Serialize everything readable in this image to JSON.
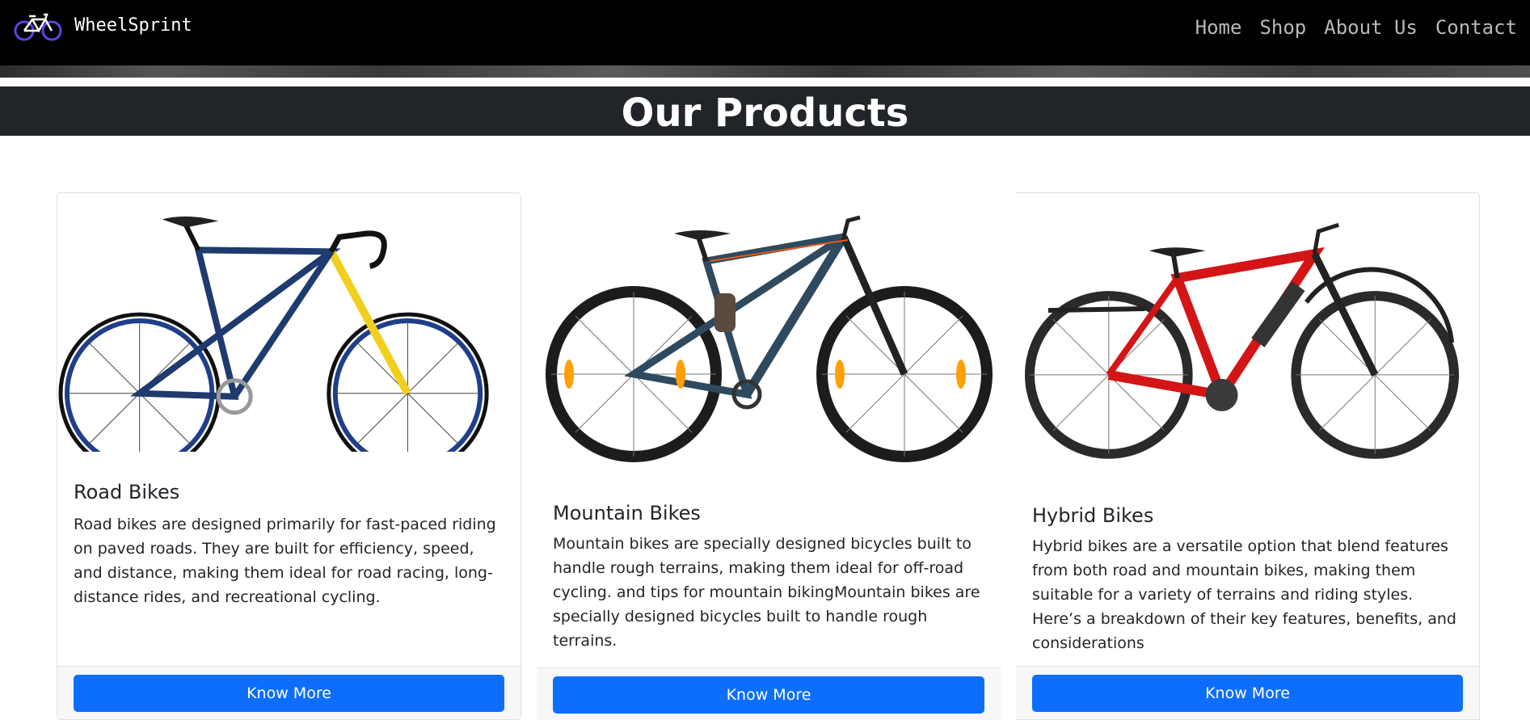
{
  "brand": {
    "name": "WheelSprint",
    "logo": "bike-icon"
  },
  "nav": {
    "items": [
      "Home",
      "Shop",
      "About Us",
      "Contact"
    ]
  },
  "section": {
    "title": "Our Products"
  },
  "products": [
    {
      "title": "Road Bikes",
      "description": "Road bikes are designed primarily for fast-paced riding on paved roads. They are built for efficiency, speed, and distance, making them ideal for road racing, long-distance rides, and recreational cycling.",
      "button": "Know More",
      "frame_color": "#1e3a6e",
      "accent_color": "#f2cf1f"
    },
    {
      "title": "Mountain Bikes",
      "description": "Mountain bikes are specially designed bicycles built to handle rough terrains, making them ideal for off-road cycling. and tips for mountain bikingMountain bikes are specially designed bicycles built to handle rough terrains.",
      "button": "Know More",
      "frame_color": "#2f4a5e",
      "accent_color": "#e35b1a"
    },
    {
      "title": "Hybrid Bikes",
      "description": "Hybrid bikes are a versatile option that blend features from both road and mountain bikes, making them suitable for a variety of terrains and riding styles. Here’s a breakdown of their key features, benefits, and considerations",
      "button": "Know More",
      "frame_color": "#d31515",
      "accent_color": "#333333"
    }
  ]
}
